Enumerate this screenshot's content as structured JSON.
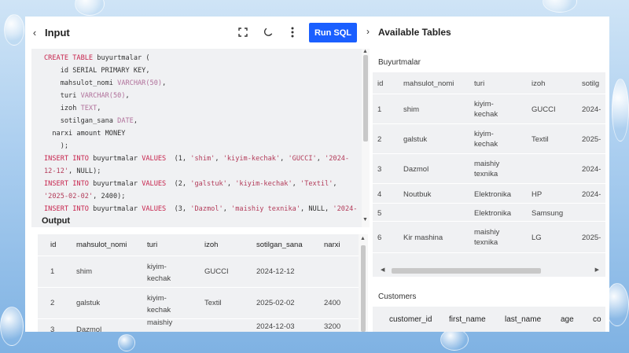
{
  "left": {
    "title": "Input",
    "run_label": "Run SQL",
    "output_label": "Output"
  },
  "code_lines": [
    [
      [
        "kw",
        "CREATE TABLE"
      ],
      [
        "",
        "buyurtmalar ("
      ]
    ],
    [
      [
        "",
        "    id SERIAL PRIMARY KEY,"
      ]
    ],
    [
      [
        "",
        "    mahsulot_nomi "
      ],
      [
        "ty",
        "VARCHAR(50)"
      ],
      [
        "",
        ","
      ]
    ],
    [
      [
        "",
        "    turi "
      ],
      [
        "ty",
        "VARCHAR(50)"
      ],
      [
        "",
        ","
      ]
    ],
    [
      [
        "",
        "    izoh "
      ],
      [
        "ty",
        "TEXT"
      ],
      [
        "",
        ","
      ]
    ],
    [
      [
        "",
        "    sotilgan_sana "
      ],
      [
        "ty",
        "DATE"
      ],
      [
        "",
        ","
      ]
    ],
    [
      [
        "",
        "  narxi amount MONEY"
      ]
    ],
    [
      [
        "",
        "    );"
      ]
    ],
    [
      [
        "kw",
        "INSERT INTO"
      ],
      [
        "",
        "buyurtmalar "
      ],
      [
        "kw",
        "VALUES"
      ],
      [
        "",
        " (1, "
      ],
      [
        "str",
        "'shim'"
      ],
      [
        "",
        ", "
      ],
      [
        "str",
        "'kiyim-kechak'"
      ],
      [
        "",
        ", "
      ],
      [
        "str",
        "'GUCCI'"
      ],
      [
        "",
        ", "
      ],
      [
        "str",
        "'2024-"
      ]
    ],
    [
      [
        "str",
        "12-12'"
      ],
      [
        "",
        ", NULL);"
      ]
    ],
    [
      [
        "kw",
        "INSERT INTO"
      ],
      [
        "",
        "buyurtmalar "
      ],
      [
        "kw",
        "VALUES"
      ],
      [
        "",
        " (2, "
      ],
      [
        "str",
        "'galstuk'"
      ],
      [
        "",
        ", "
      ],
      [
        "str",
        "'kiyim-kechak'"
      ],
      [
        "",
        ", "
      ],
      [
        "str",
        "'Textil'"
      ],
      [
        "",
        ","
      ]
    ],
    [
      [
        "str",
        "'2025-02-02'"
      ],
      [
        "",
        ", 2400);"
      ]
    ],
    [
      [
        "kw",
        "INSERT INTO"
      ],
      [
        "",
        "buyurtmalar "
      ],
      [
        "kw",
        "VALUES"
      ],
      [
        "",
        " (3, "
      ],
      [
        "str",
        "'Dazmol'"
      ],
      [
        "",
        ", "
      ],
      [
        "str",
        "'maishiy texnika'"
      ],
      [
        "",
        ", NULL, "
      ],
      [
        "str",
        "'2024-"
      ]
    ]
  ],
  "output": {
    "columns": [
      "id",
      "mahsulot_nomi",
      "turi",
      "izoh",
      "sotilgan_sana",
      "narxi"
    ],
    "rows": [
      [
        "1",
        "shim",
        "kiyim-kechak",
        "GUCCI",
        "2024-12-12",
        ""
      ],
      [
        "2",
        "galstuk",
        "kiyim-kechak",
        "Textil",
        "2025-02-02",
        "2400"
      ],
      [
        "3",
        "Dazmol",
        "maishiy",
        "",
        "2024-12-03",
        "3200"
      ]
    ]
  },
  "right": {
    "title": "Available Tables",
    "table1_name": "Buyurtmalar",
    "table1_columns": [
      "id",
      "mahsulot_nomi",
      "turi",
      "izoh",
      "sotilg"
    ],
    "table1_rows": [
      [
        "1",
        "shim",
        "kiyim-kechak",
        "GUCCI",
        "2024-"
      ],
      [
        "2",
        "galstuk",
        "kiyim-kechak",
        "Textil",
        "2025-"
      ],
      [
        "3",
        "Dazmol",
        "maishiy texnika",
        "",
        "2024-"
      ],
      [
        "4",
        "Noutbuk",
        "Elektronika",
        "HP",
        "2024-"
      ],
      [
        "5",
        "",
        "Elektronika",
        "Samsung",
        ""
      ],
      [
        "6",
        "Kir mashina",
        "maishiy texnika",
        "LG",
        "2025-"
      ]
    ],
    "table2_name": "Customers",
    "table2_columns": [
      "customer_id",
      "first_name",
      "last_name",
      "age",
      "co"
    ]
  },
  "colors": {
    "accent": "#1a5fff",
    "keyword": "#c7254e",
    "type": "#b0709a"
  },
  "icons": [
    "chevron-left-icon",
    "fullscreen-icon",
    "moon-icon",
    "more-vertical-icon",
    "chevron-right-icon"
  ]
}
